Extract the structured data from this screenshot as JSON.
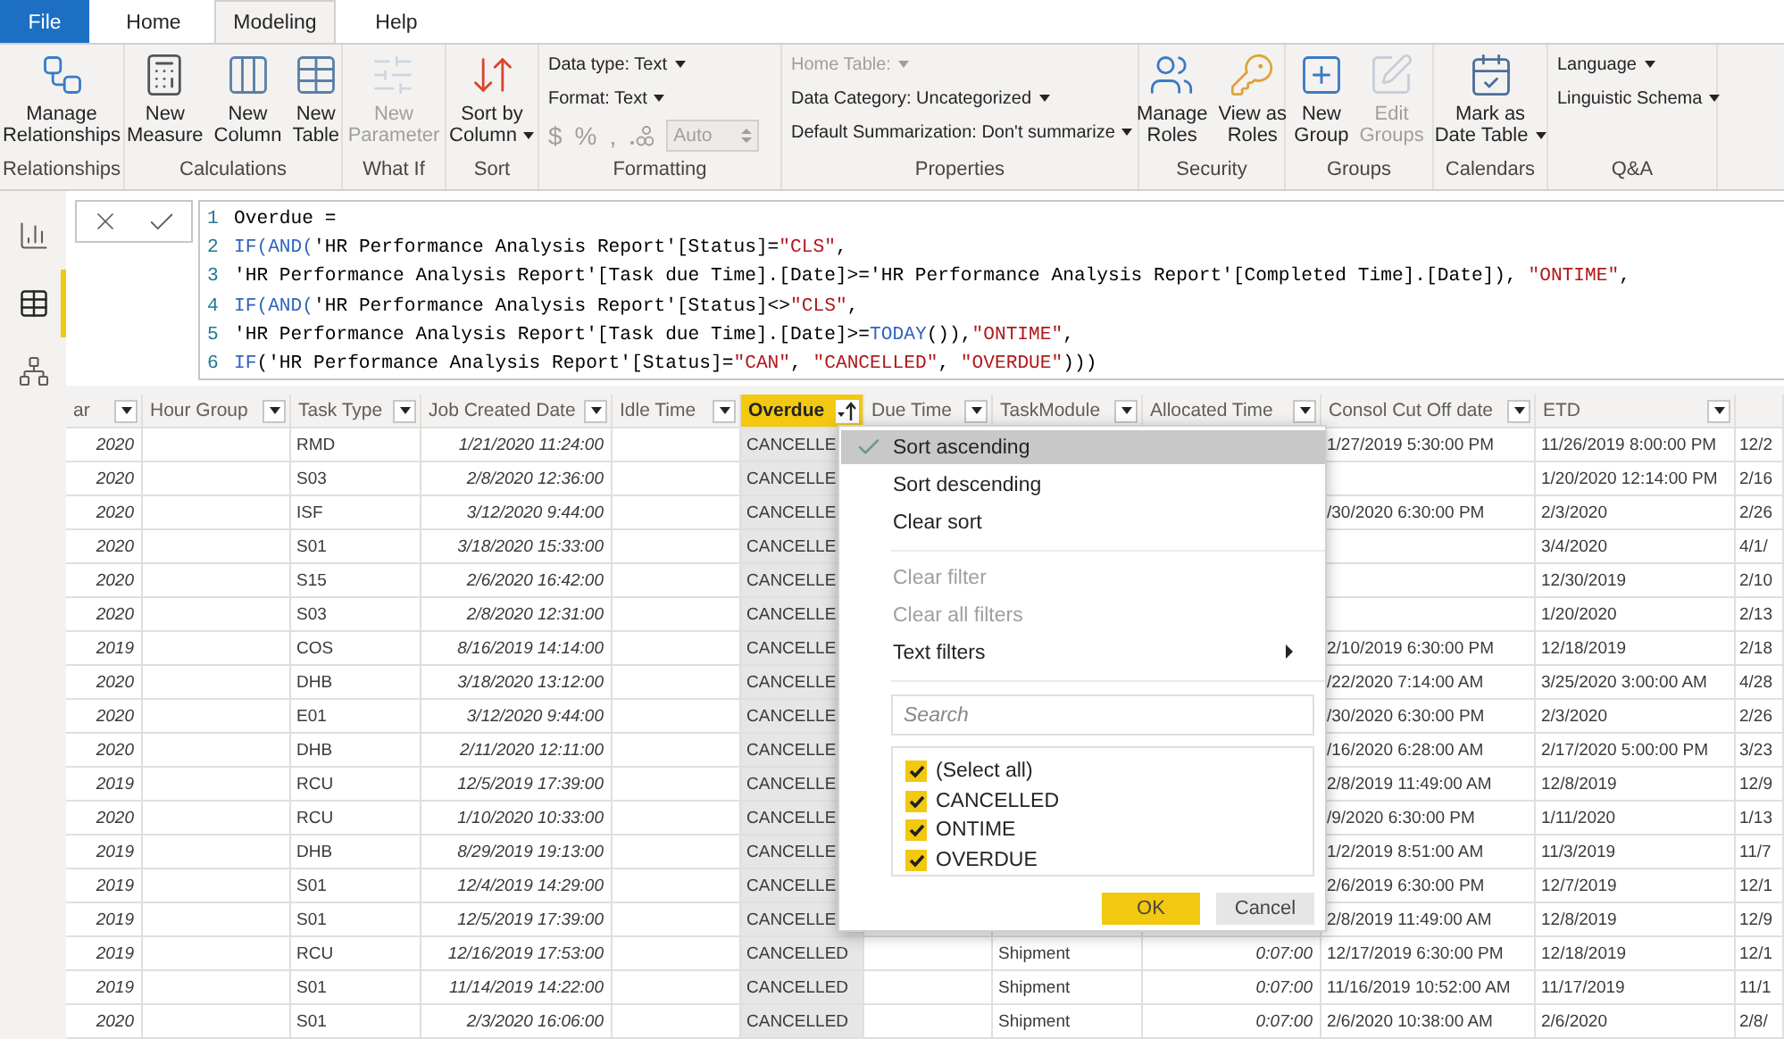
{
  "tabs": [
    {
      "label": "File",
      "kind": "file",
      "selected": false
    },
    {
      "label": "Home",
      "kind": "tab",
      "selected": false
    },
    {
      "label": "Modeling",
      "kind": "tab",
      "selected": true
    },
    {
      "label": "Help",
      "kind": "tab",
      "selected": false
    }
  ],
  "ribbon": {
    "groups": [
      {
        "label": "Relationships",
        "kind": "buttons",
        "buttons": [
          {
            "label": "Manage\nRelationships",
            "disabled": false,
            "dropdown": false
          }
        ]
      },
      {
        "label": "Calculations",
        "kind": "buttons",
        "buttons": [
          {
            "label": "New\nMeasure",
            "disabled": false,
            "dropdown": false
          },
          {
            "label": "New\nColumn",
            "disabled": false,
            "dropdown": false
          },
          {
            "label": "New\nTable",
            "disabled": false,
            "dropdown": false
          }
        ]
      },
      {
        "label": "What If",
        "kind": "buttons",
        "buttons": [
          {
            "label": "New\nParameter",
            "disabled": true,
            "dropdown": false
          }
        ]
      },
      {
        "label": "Sort",
        "kind": "buttons",
        "buttons": [
          {
            "label": "Sort by\nColumn",
            "disabled": false,
            "dropdown": true
          }
        ]
      },
      {
        "label": "Formatting",
        "kind": "formatting",
        "menus": [
          {
            "label": "Data type: Text",
            "disabled": false,
            "dropdown": true
          },
          {
            "label": "Format: Text",
            "disabled": false,
            "dropdown": true
          }
        ],
        "number_format": {
          "currency": "$",
          "percent": "%",
          "comma": ",",
          "auto": "Auto",
          "disabled": true
        }
      },
      {
        "label": "Properties",
        "kind": "menus",
        "menus": [
          {
            "label": "Home Table:",
            "disabled": true,
            "dropdown": true
          },
          {
            "label": "Data Category: Uncategorized",
            "disabled": false,
            "dropdown": true
          },
          {
            "label": "Default Summarization: Don't summarize",
            "disabled": false,
            "dropdown": true
          }
        ]
      },
      {
        "label": "Security",
        "kind": "buttons",
        "buttons": [
          {
            "label": "Manage\nRoles",
            "disabled": false,
            "dropdown": false
          },
          {
            "label": "View as\nRoles",
            "disabled": false,
            "dropdown": false
          }
        ]
      },
      {
        "label": "Groups",
        "kind": "buttons",
        "buttons": [
          {
            "label": "New\nGroup",
            "disabled": false,
            "dropdown": false
          },
          {
            "label": "Edit\nGroups",
            "disabled": true,
            "dropdown": false
          }
        ]
      },
      {
        "label": "Calendars",
        "kind": "buttons",
        "buttons": [
          {
            "label": "Mark as\nDate Table",
            "disabled": false,
            "dropdown": true
          }
        ]
      },
      {
        "label": "Q&A",
        "kind": "menus",
        "menus": [
          {
            "label": "Language",
            "disabled": false,
            "dropdown": true
          },
          {
            "label": "Linguistic Schema",
            "disabled": false,
            "dropdown": true
          }
        ]
      }
    ]
  },
  "nav": [
    {
      "kind": "report",
      "selected": false
    },
    {
      "kind": "data",
      "selected": true
    },
    {
      "kind": "model",
      "selected": false
    }
  ],
  "formula": {
    "lines": [
      {
        "number": "1",
        "tokens": [
          {
            "kind": "text",
            "text": "Overdue ="
          }
        ]
      },
      {
        "number": "2",
        "tokens": [
          {
            "kind": "function",
            "text": "IF(AND("
          },
          {
            "kind": "text",
            "text": "'HR Performance Analysis Report'[Status]="
          },
          {
            "kind": "string",
            "text": "\"CLS\""
          },
          {
            "kind": "text",
            "text": ","
          }
        ]
      },
      {
        "number": "3",
        "tokens": [
          {
            "kind": "text",
            "text": "'HR Performance Analysis Report'[Task due Time].[Date]>='HR Performance Analysis Report'[Completed Time].[Date]), "
          },
          {
            "kind": "string",
            "text": "\"ONTIME\""
          },
          {
            "kind": "text",
            "text": ","
          }
        ]
      },
      {
        "number": "4",
        "tokens": [
          {
            "kind": "function",
            "text": "IF(AND("
          },
          {
            "kind": "text",
            "text": "'HR Performance Analysis Report'[Status]<>"
          },
          {
            "kind": "string",
            "text": "\"CLS\""
          },
          {
            "kind": "text",
            "text": ","
          }
        ]
      },
      {
        "number": "5",
        "tokens": [
          {
            "kind": "text",
            "text": "'HR Performance Analysis Report'[Task due Time].[Date]>="
          },
          {
            "kind": "function",
            "text": "TODAY"
          },
          {
            "kind": "text",
            "text": "()),"
          },
          {
            "kind": "string",
            "text": "\"ONTIME\""
          },
          {
            "kind": "text",
            "text": ","
          }
        ]
      },
      {
        "number": "6",
        "tokens": [
          {
            "kind": "function",
            "text": "IF"
          },
          {
            "kind": "text",
            "text": "('HR Performance Analysis Report'[Status]="
          },
          {
            "kind": "string",
            "text": "\"CAN\""
          },
          {
            "kind": "text",
            "text": ", "
          },
          {
            "kind": "string",
            "text": "\"CANCELLED\""
          },
          {
            "kind": "text",
            "text": ", "
          },
          {
            "kind": "string",
            "text": "\"OVERDUE\""
          },
          {
            "kind": "text",
            "text": ")))"
          }
        ]
      }
    ]
  },
  "table": {
    "columns": [
      {
        "label": "ar",
        "selected": false,
        "sorted": false
      },
      {
        "label": "Hour Group",
        "selected": false,
        "sorted": false
      },
      {
        "label": "Task Type",
        "selected": false,
        "sorted": false
      },
      {
        "label": "Job Created Date",
        "selected": false,
        "sorted": false
      },
      {
        "label": "Idle Time",
        "selected": false,
        "sorted": false
      },
      {
        "label": "Overdue",
        "selected": true,
        "sorted": true
      },
      {
        "label": "Due Time",
        "selected": false,
        "sorted": false
      },
      {
        "label": "TaskModule",
        "selected": false,
        "sorted": false
      },
      {
        "label": "Allocated Time",
        "selected": false,
        "sorted": false
      },
      {
        "label": "Consol Cut Off date",
        "selected": false,
        "sorted": false
      },
      {
        "label": "ETD",
        "selected": false,
        "sorted": false
      }
    ],
    "rows": [
      [
        "2020",
        null,
        "RMD",
        "1/21/2020 11:24:00",
        null,
        "CANCELLE",
        null,
        null,
        null,
        "1/27/2019 5:30:00 PM",
        "11/26/2019 8:00:00 PM",
        "12/2"
      ],
      [
        "2020",
        null,
        "S03",
        "2/8/2020 12:36:00",
        null,
        "CANCELLE",
        null,
        null,
        null,
        null,
        "1/20/2020 12:14:00 PM",
        "2/16"
      ],
      [
        "2020",
        null,
        "ISF",
        "3/12/2020 9:44:00",
        null,
        "CANCELLE",
        null,
        null,
        null,
        "/30/2020 6:30:00 PM",
        "2/3/2020",
        "2/26"
      ],
      [
        "2020",
        null,
        "S01",
        "3/18/2020 15:33:00",
        null,
        "CANCELLE",
        null,
        null,
        null,
        null,
        "3/4/2020",
        "4/1/"
      ],
      [
        "2020",
        null,
        "S15",
        "2/6/2020 16:42:00",
        null,
        "CANCELLE",
        null,
        null,
        null,
        null,
        "12/30/2019",
        "2/10"
      ],
      [
        "2020",
        null,
        "S03",
        "2/8/2020 12:31:00",
        null,
        "CANCELLE",
        null,
        null,
        null,
        null,
        "1/20/2020",
        "2/13"
      ],
      [
        "2019",
        null,
        "COS",
        "8/16/2019 14:14:00",
        null,
        "CANCELLE",
        null,
        null,
        null,
        "2/10/2019 6:30:00 PM",
        "12/18/2019",
        "2/18"
      ],
      [
        "2020",
        null,
        "DHB",
        "3/18/2020 13:12:00",
        null,
        "CANCELLE",
        null,
        null,
        null,
        "/22/2020 7:14:00 AM",
        "3/25/2020 3:00:00 AM",
        "4/28"
      ],
      [
        "2020",
        null,
        "E01",
        "3/12/2020 9:44:00",
        null,
        "CANCELLE",
        null,
        null,
        null,
        "/30/2020 6:30:00 PM",
        "2/3/2020",
        "2/26"
      ],
      [
        "2020",
        null,
        "DHB",
        "2/11/2020 12:11:00",
        null,
        "CANCELLE",
        null,
        null,
        null,
        "/16/2020 6:28:00 AM",
        "2/17/2020 5:00:00 PM",
        "3/23"
      ],
      [
        "2019",
        null,
        "RCU",
        "12/5/2019 17:39:00",
        null,
        "CANCELLE",
        null,
        null,
        null,
        "2/8/2019 11:49:00 AM",
        "12/8/2019",
        "12/9"
      ],
      [
        "2020",
        null,
        "RCU",
        "1/10/2020 10:33:00",
        null,
        "CANCELLE",
        null,
        null,
        null,
        "/9/2020 6:30:00 PM",
        "1/11/2020",
        "1/13"
      ],
      [
        "2019",
        null,
        "DHB",
        "8/29/2019 19:13:00",
        null,
        "CANCELLE",
        null,
        null,
        null,
        "1/2/2019 8:51:00 AM",
        "11/3/2019",
        "11/7"
      ],
      [
        "2019",
        null,
        "S01",
        "12/4/2019 14:29:00",
        null,
        "CANCELLE",
        null,
        null,
        null,
        "2/6/2019 6:30:00 PM",
        "12/7/2019",
        "12/1"
      ],
      [
        "2019",
        null,
        "S01",
        "12/5/2019 17:39:00",
        null,
        "CANCELLE",
        null,
        null,
        null,
        "2/8/2019 11:49:00 AM",
        "12/8/2019",
        "12/9"
      ],
      [
        "2019",
        null,
        "RCU",
        "12/16/2019 17:53:00",
        null,
        "CANCELLED",
        null,
        "Shipment",
        "0:07:00",
        "12/17/2019 6:30:00 PM",
        "12/18/2019",
        "12/1"
      ],
      [
        "2019",
        null,
        "S01",
        "11/14/2019 14:22:00",
        null,
        "CANCELLED",
        null,
        "Shipment",
        "0:07:00",
        "11/16/2019 10:52:00 AM",
        "11/17/2019",
        "11/1"
      ],
      [
        "2020",
        null,
        "S01",
        "2/3/2020 16:06:00",
        null,
        "CANCELLED",
        null,
        "Shipment",
        "0:07:00",
        "2/6/2020 10:38:00 AM",
        "2/6/2020",
        "2/8/"
      ]
    ]
  },
  "filter_menu": {
    "sort_items": [
      {
        "label": "Sort ascending",
        "selected": true,
        "disabled": false,
        "submenu": false
      },
      {
        "label": "Sort descending",
        "selected": false,
        "disabled": false,
        "submenu": false
      },
      {
        "label": "Clear sort",
        "selected": false,
        "disabled": false,
        "submenu": false
      }
    ],
    "filter_items": [
      {
        "label": "Clear filter",
        "selected": false,
        "disabled": true,
        "submenu": false
      },
      {
        "label": "Clear all filters",
        "selected": false,
        "disabled": true,
        "submenu": false
      },
      {
        "label": "Text filters",
        "selected": false,
        "disabled": false,
        "submenu": true
      }
    ],
    "search": {
      "placeholder": "Search"
    },
    "checklist": [
      {
        "label": "(Select all)",
        "checked": true
      },
      {
        "label": "CANCELLED",
        "checked": true
      },
      {
        "label": "ONTIME",
        "checked": true
      },
      {
        "label": "OVERDUE",
        "checked": true
      }
    ],
    "buttons": [
      {
        "label": "OK",
        "kind": "primary"
      },
      {
        "label": "Cancel",
        "kind": "secondary"
      }
    ]
  }
}
